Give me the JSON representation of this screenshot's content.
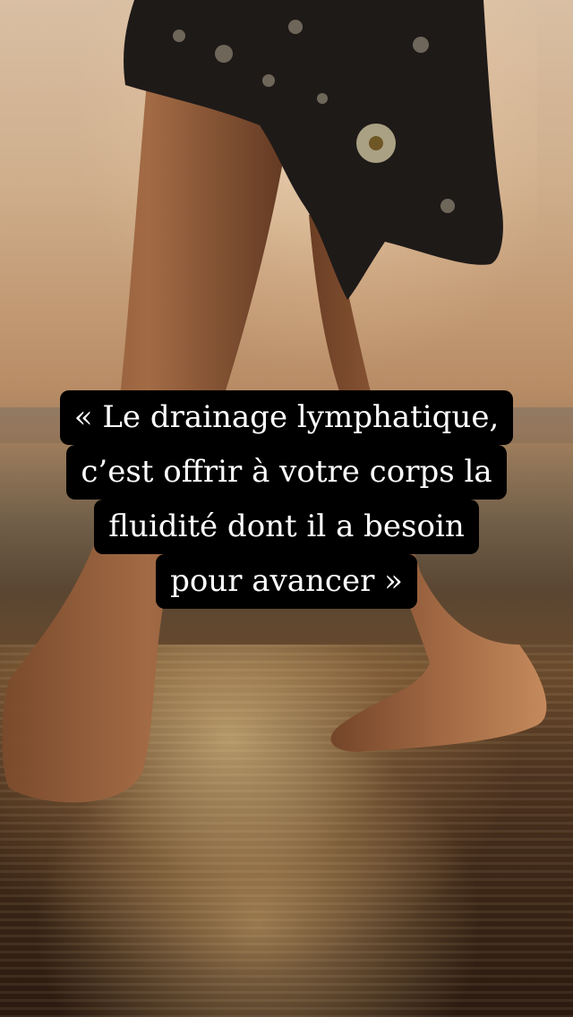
{
  "quote": {
    "lines": [
      "« Le drainage lymphatique,",
      "c’est offrir à votre corps la",
      "fluidité dont il a besoin",
      "pour avancer »"
    ]
  },
  "scene": {
    "icon": "sunset-beach-legs-photo",
    "colors": {
      "sky": "#d9bfa3",
      "sand": "#4d3320",
      "highlight": "#ffe1a0",
      "caption_bg": "#000000",
      "caption_text": "#ffffff"
    }
  }
}
